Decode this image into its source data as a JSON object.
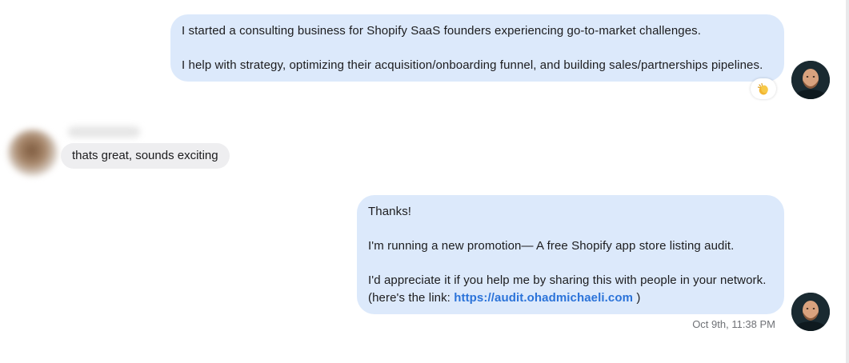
{
  "messages": [
    {
      "sender": "self",
      "paragraphs": [
        "I started a consulting business for Shopify SaaS founders experiencing go-to-market challenges.",
        "I help with strategy, optimizing their acquisition/onboarding funnel, and building sales/partnerships pipelines."
      ],
      "reaction_icon": "clapping-hands-emoji"
    },
    {
      "sender": "contact",
      "text": "thats great, sounds exciting"
    },
    {
      "sender": "self",
      "greeting": "Thanks!",
      "promo": "I'm running a new promotion— A free Shopify app store listing audit.",
      "request": "I'd appreciate it if you help me by sharing this with people in your network.",
      "link_prefix": "(here's the link: ",
      "link_text": "https://audit.ohadmichaeli.com",
      "link_suffix": " )",
      "timestamp": "Oct 9th, 11:38 PM"
    }
  ],
  "colors": {
    "outgoing_bubble": "#dce9fb",
    "incoming_bubble": "#eeeef0",
    "link": "#2b73d9",
    "timestamp": "#707277"
  }
}
